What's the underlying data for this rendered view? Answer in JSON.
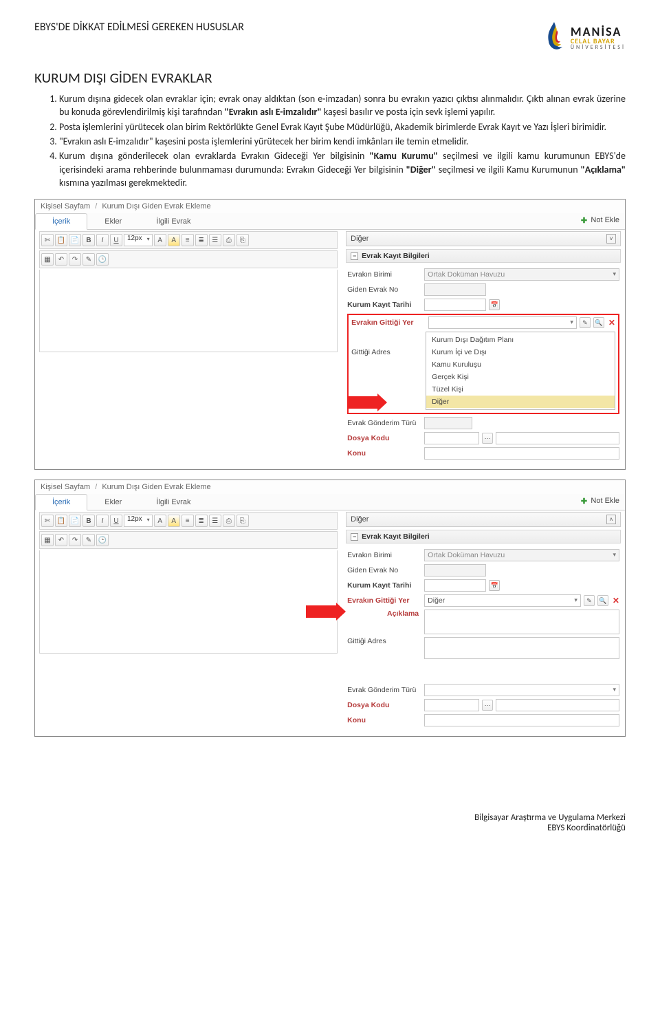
{
  "header": {
    "doc_title": "EBYS'DE DİKKAT EDİLMESİ GEREKEN HUSUSLAR"
  },
  "logo": {
    "line1": "MANİSA",
    "line2": "CELAL BAYAR",
    "line3": "ÜNİVERSİTESİ"
  },
  "section_title": "KURUM DIŞI GİDEN EVRAKLAR",
  "items": {
    "i1": "Kurum dışına gidecek olan evraklar için; evrak onay aldıktan (son e-imzadan) sonra bu evrakın yazıcı çıktısı alınmalıdır. Çıktı alınan evrak üzerine bu konuda görevlendirilmiş kişi tarafından ",
    "i1b": "\"Evrakın aslı E-imzalıdır\"",
    "i1c": " kaşesi basılır ve posta için sevk işlemi yapılır.",
    "i2": "Posta işlemlerini yürütecek olan birim Rektörlükte Genel Evrak Kayıt Şube Müdürlüğü, Akademik birimlerde Evrak Kayıt ve Yazı İşleri birimidir.",
    "i3": "\"Evrakın aslı E-imzalıdır\" kaşesini posta işlemlerini yürütecek her birim kendi imkânları ile temin etmelidir.",
    "i4a": "Kurum dışına gönderilecek olan evraklarda Evrakın Gideceği Yer bilgisinin ",
    "i4b": "\"Kamu Kurumu\"",
    "i4c": " seçilmesi ve ilgili kamu kurumunun EBYS'de içerisindeki arama rehberinde bulunmaması durumunda: Evrakın Gideceği Yer bilgisinin ",
    "i4d": "\"Diğer\"",
    "i4e": " seçilmesi ve ilgili Kamu Kurumunun ",
    "i4f": "\"Açıklama\"",
    "i4g": " kısmına yazılması gerekmektedir."
  },
  "app": {
    "breadcrumb": {
      "p1": "Kişisel Sayfam",
      "p2": "Kurum Dışı Giden Evrak Ekleme"
    },
    "tabs": {
      "icerik": "İçerik",
      "ekler": "Ekler",
      "ilgili": "İlgili Evrak"
    },
    "not_ekle": "Not Ekle",
    "font_size": "12px",
    "right_header": "Diğer",
    "panel_title": "Evrak Kayıt Bilgileri",
    "labels": {
      "evrakin_birimi": "Evrakın Birimi",
      "giden_evrak_no": "Giden Evrak No",
      "kurum_kayit_tarihi": "Kurum Kayıt Tarihi",
      "evrakin_gittigi_yer": "Evrakın Gittiği Yer",
      "gittigi_adres": "Gittiği Adres",
      "evrak_gonderim_turu": "Evrak Gönderim Türü",
      "dosya_kodu": "Dosya Kodu",
      "konu": "Konu",
      "aciklama": "Açıklama"
    },
    "values": {
      "evrakin_birimi": "Ortak Doküman Havuzu",
      "yer_selected_2": "Diğer"
    },
    "dropdown_options": [
      "Kurum Dışı Dağıtım Planı",
      "Kurum İçi ve Dışı",
      "Kamu Kuruluşu",
      "Gerçek Kişi",
      "Tüzel Kişi",
      "Diğer"
    ]
  },
  "footer": {
    "l1": "Bilgisayar Araştırma ve Uygulama Merkezi",
    "l2": "EBYS Koordinatörlüğü"
  }
}
